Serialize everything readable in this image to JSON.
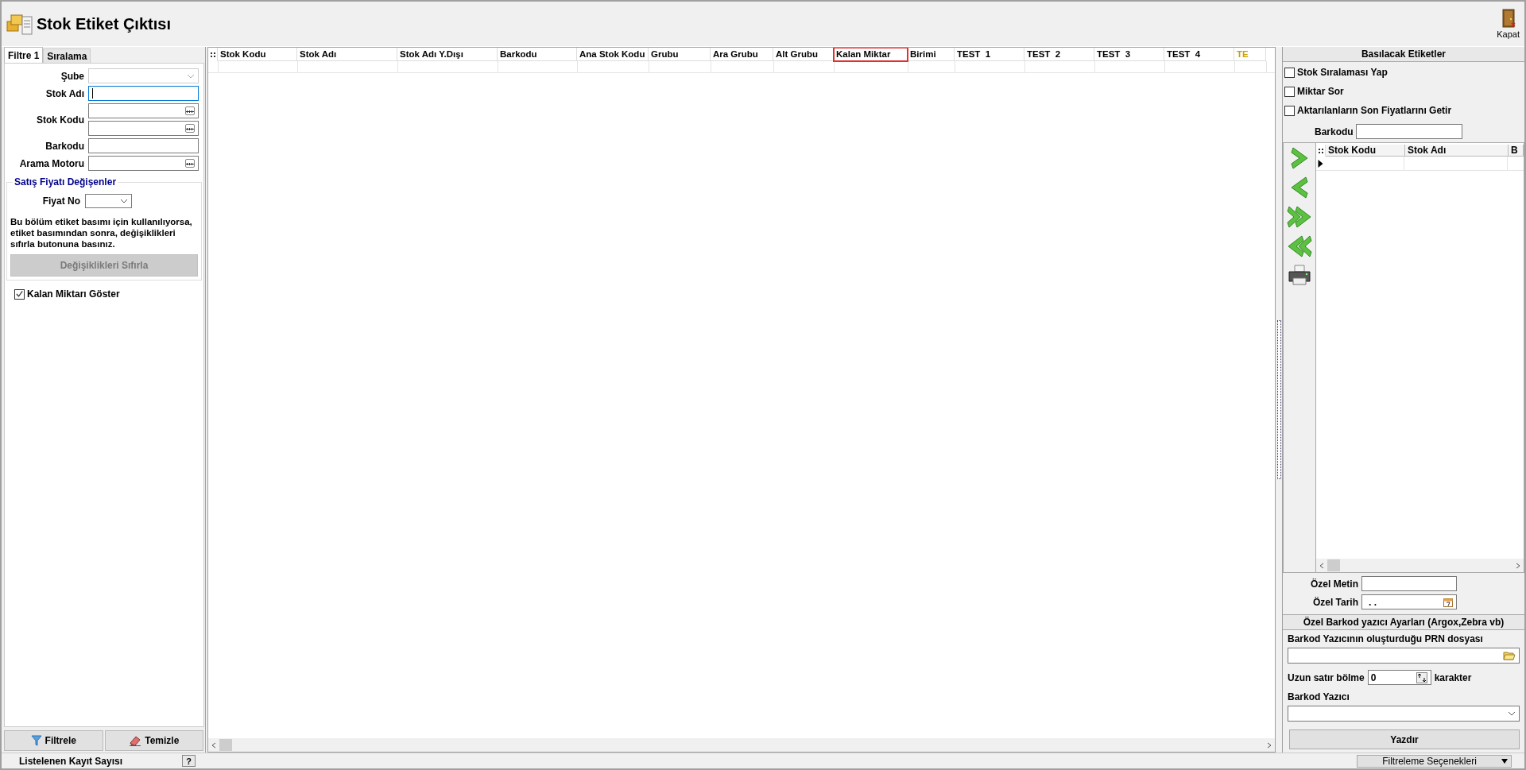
{
  "window": {
    "title": "Stok Etiket Çıktısı",
    "close_label": "Kapat"
  },
  "filter_panel": {
    "tabs": [
      {
        "label": "Filtre 1",
        "selected": true
      },
      {
        "label": "Sıralama",
        "selected": false
      }
    ],
    "fields": [
      {
        "kind": "select",
        "label": "Şube",
        "focused": false
      },
      {
        "kind": "text",
        "label": "Stok Adı",
        "focused": true
      },
      {
        "kind": "range",
        "label": "Stok Kodu",
        "focused": false
      },
      {
        "kind": "text",
        "label": "Barkodu",
        "focused": false
      },
      {
        "kind": "lookup",
        "label": "Arama Motoru",
        "focused": false
      }
    ],
    "price_group": {
      "title": "Satış Fiyatı Değişenler",
      "price_label": "Fiyat No",
      "note": "Bu bölüm etiket basımı için kullanılıyorsa, etiket basımından sonra, değişiklikleri sıfırla butonuna basınız.",
      "reset_button": {
        "label": "Değişiklikleri Sıfırla",
        "disabled": true
      }
    },
    "show_remaining": {
      "label": "Kalan Miktarı Göster",
      "checked": true
    },
    "buttons": [
      {
        "kind": "filter",
        "label": "Filtrele"
      },
      {
        "kind": "clear",
        "label": "Temizle"
      }
    ]
  },
  "grid": {
    "columns": [
      {
        "label": "Stok Kodu",
        "marked": false,
        "highlighted": false
      },
      {
        "label": "Stok Adı",
        "marked": false,
        "highlighted": false
      },
      {
        "label": "Stok Adı Y.Dışı",
        "marked": false,
        "highlighted": false
      },
      {
        "label": "Barkodu",
        "marked": false,
        "highlighted": false
      },
      {
        "label": "Ana Stok Kodu",
        "marked": false,
        "highlighted": false
      },
      {
        "label": "Grubu",
        "marked": false,
        "highlighted": false
      },
      {
        "label": "Ara Grubu",
        "marked": false,
        "highlighted": false
      },
      {
        "label": "Alt Grubu",
        "marked": false,
        "highlighted": false
      },
      {
        "label": "Kalan Miktar",
        "marked": true,
        "highlighted": false
      },
      {
        "label": "Birimi",
        "marked": false,
        "highlighted": false
      },
      {
        "label": "TEST  1",
        "marked": false,
        "highlighted": false
      },
      {
        "label": "TEST  2",
        "marked": false,
        "highlighted": false
      },
      {
        "label": "TEST  3",
        "marked": false,
        "highlighted": false
      },
      {
        "label": "TEST  4",
        "marked": false,
        "highlighted": false
      },
      {
        "label": "TE",
        "marked": false,
        "highlighted": true
      }
    ]
  },
  "labels_panel": {
    "title": "Basılacak Etiketler",
    "options": [
      {
        "label": "Stok Sıralaması Yap",
        "checked": false
      },
      {
        "label": "Miktar Sor",
        "checked": false
      },
      {
        "label": "Aktarılanların Son Fiyatlarını Getir",
        "checked": false
      }
    ],
    "barcode_label": "Barkodu",
    "tools": [
      {
        "kind": "add"
      },
      {
        "kind": "remove"
      },
      {
        "kind": "add_all"
      },
      {
        "kind": "remove_all"
      },
      {
        "kind": "print"
      }
    ],
    "columns": [
      "Stok Kodu",
      "Stok Adı",
      "B"
    ],
    "custom_text_label": "Özel Metin",
    "custom_date_label": "Özel Tarih",
    "custom_date_value": ". ."
  },
  "printer_settings": {
    "title": "Özel Barkod yazıcı Ayarları (Argox,Zebra vb)",
    "prn_label": "Barkod Yazıcının oluşturduğu PRN dosyası",
    "split_label": "Uzun satır bölme",
    "split_value": "0",
    "split_unit": "karakter",
    "printer_label": "Barkod Yazıcı",
    "print_button": "Yazdır"
  },
  "status_bar": {
    "record_count_label": "Listelenen Kayıt Sayısı",
    "help": "?",
    "filter_options": "Filtreleme Seçenekleri"
  }
}
